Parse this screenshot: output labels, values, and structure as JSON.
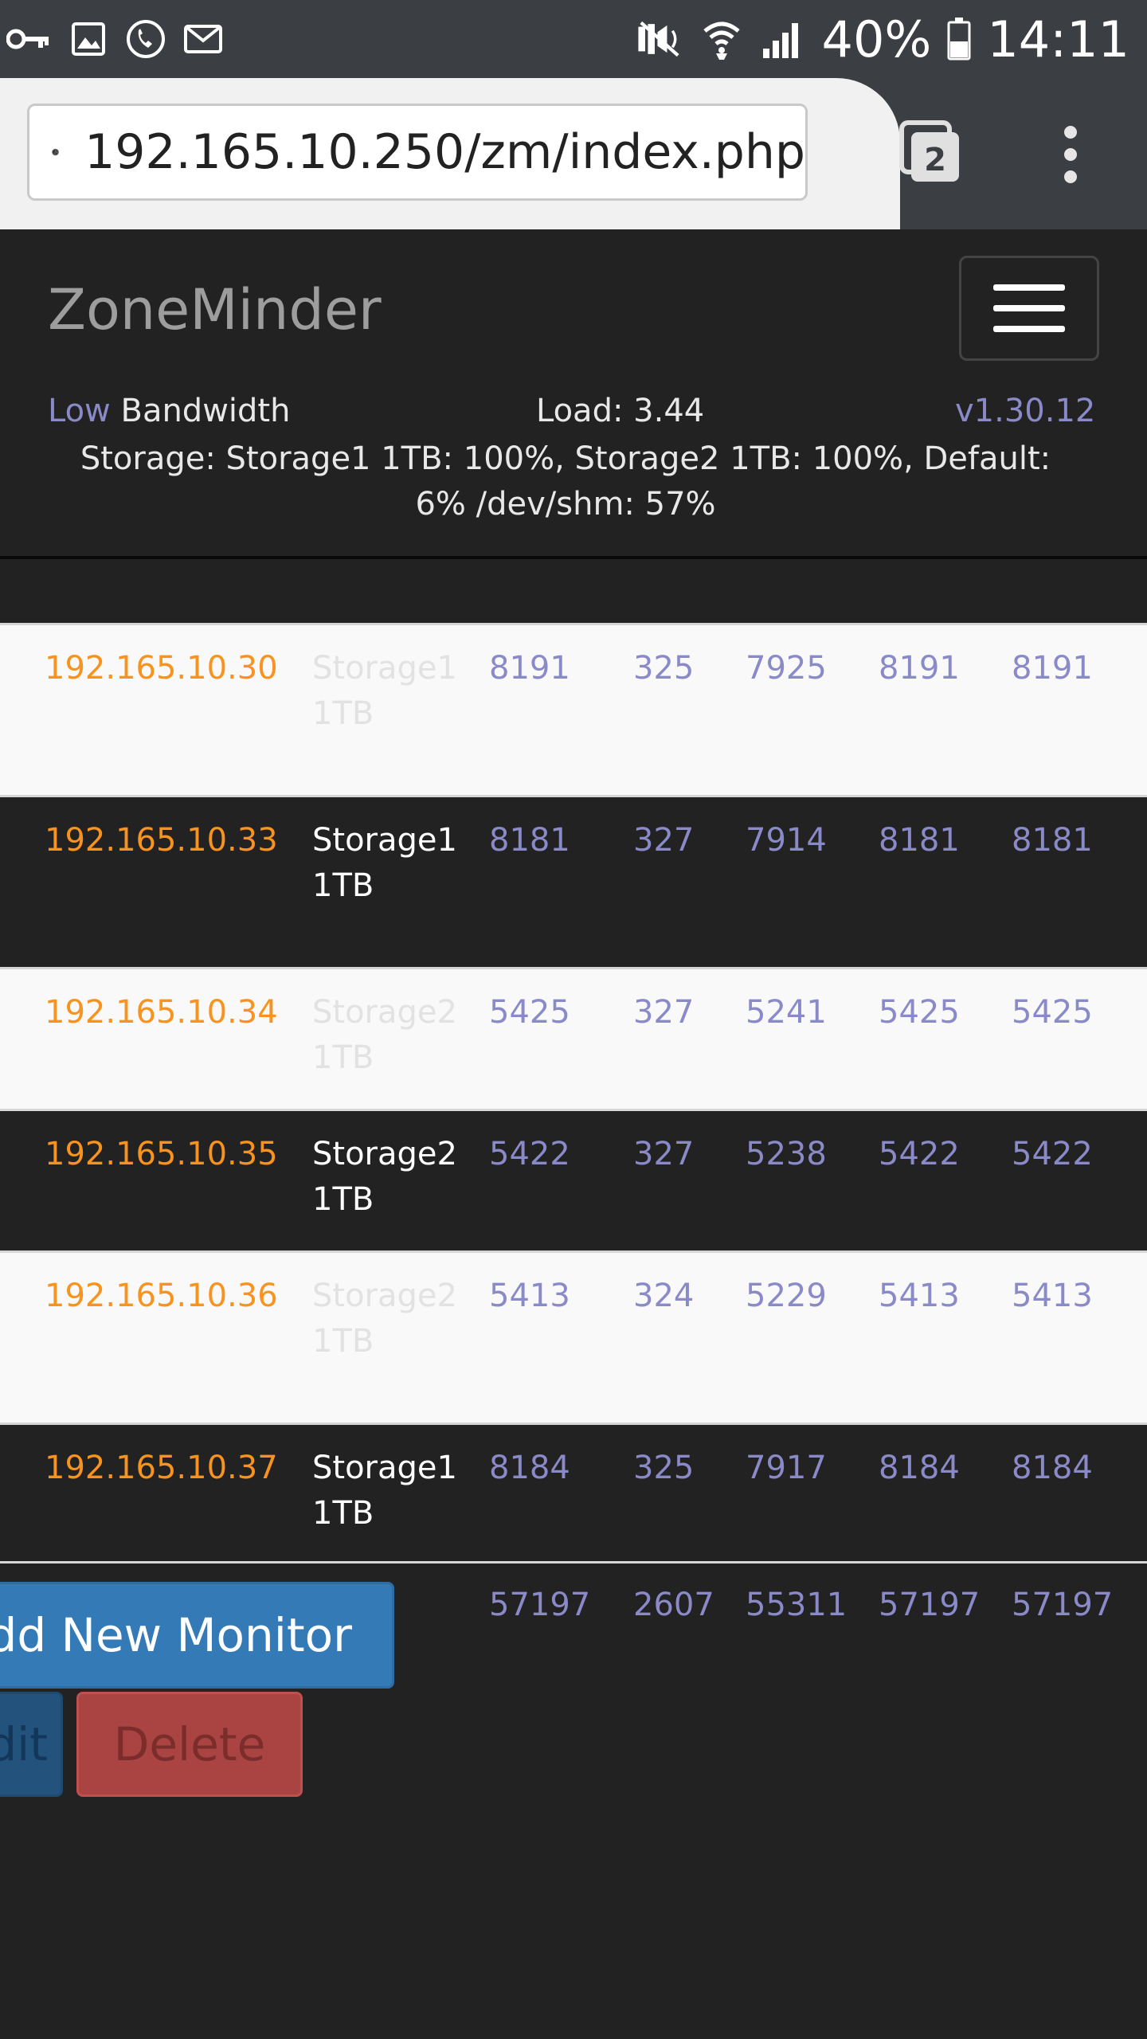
{
  "status_bar": {
    "battery": "40%",
    "time": "14:11",
    "left_icons": [
      "key-icon",
      "image-icon",
      "call-icon",
      "mail-icon"
    ],
    "right_icons": [
      "mute-icon",
      "wifi-icon",
      "signal-icon",
      "battery-icon"
    ]
  },
  "browser": {
    "url": "192.165.10.250/zm/index.php",
    "tab_count": "2"
  },
  "navbar": {
    "brand": "ZoneMinder",
    "bandwidth_low": "Low",
    "bandwidth_label": "Bandwidth",
    "load": "Load: 3.44",
    "version": "v1.30.12",
    "storage_line1": "Storage: Storage1 1TB: 100%, Storage2 1TB: 100%, Default:",
    "storage_line2": "6% /dev/shm: 57%"
  },
  "monitors": [
    {
      "name": "192.165.10.30",
      "storage": "Storage1 1TB",
      "values": [
        "8191",
        "325",
        "7925",
        "8191",
        "8191"
      ]
    },
    {
      "name": "192.165.10.33",
      "storage": "Storage1 1TB",
      "values": [
        "8181",
        "327",
        "7914",
        "8181",
        "8181"
      ]
    },
    {
      "name": "192.165.10.34",
      "storage": "Storage2 1TB",
      "values": [
        "5425",
        "327",
        "5241",
        "5425",
        "5425"
      ]
    },
    {
      "name": "192.165.10.35",
      "storage": "Storage2 1TB",
      "values": [
        "5422",
        "327",
        "5238",
        "5422",
        "5422"
      ]
    },
    {
      "name": "192.165.10.36",
      "storage": "Storage2 1TB",
      "values": [
        "5413",
        "324",
        "5229",
        "5413",
        "5413"
      ]
    },
    {
      "name": "192.165.10.37",
      "storage": "Storage1 1TB",
      "values": [
        "8184",
        "325",
        "7917",
        "8184",
        "8184"
      ]
    }
  ],
  "totals": [
    "57197",
    "2607",
    "55311",
    "57197",
    "57197"
  ],
  "buttons": {
    "add": "Add New Monitor",
    "edit": "Edit",
    "delete": "Delete"
  },
  "colors": {
    "accent_orange": "#f7931e",
    "number_purple": "#8a8ac8",
    "primary_blue": "#337ab7",
    "danger_red": "#a94442"
  }
}
